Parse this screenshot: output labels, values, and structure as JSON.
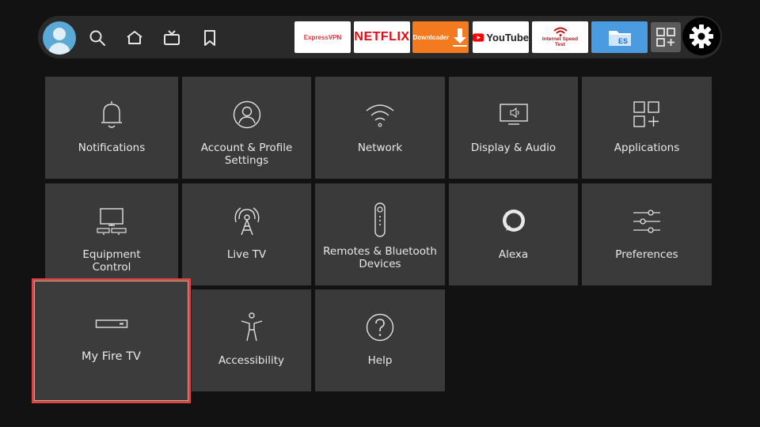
{
  "topbar": {
    "nav_icons": [
      "profile-avatar",
      "search-icon",
      "home-icon",
      "live-tv-icon",
      "bookmark-icon"
    ],
    "apps": [
      {
        "name": "ExpressVPN",
        "bg": "#ffffff",
        "fg": "#da3940"
      },
      {
        "name": "NETFLIX",
        "bg": "#ffffff",
        "fg": "#e50914"
      },
      {
        "name": "Downloader",
        "bg": "#f47a20",
        "fg": "#ffffff"
      },
      {
        "name": "YouTube",
        "bg": "#ffffff",
        "fg": "#222222"
      },
      {
        "name": "Internet Speed Test",
        "bg": "#ffffff",
        "fg": "#c0121b"
      },
      {
        "name": "ES",
        "bg": "#4a9be0",
        "fg": "#ffffff"
      }
    ]
  },
  "settings": {
    "tiles": [
      {
        "label": "Notifications",
        "icon": "bell-icon"
      },
      {
        "label": "Account & Profile Settings",
        "icon": "account-icon"
      },
      {
        "label": "Network",
        "icon": "wifi-icon"
      },
      {
        "label": "Display & Audio",
        "icon": "display-audio-icon"
      },
      {
        "label": "Applications",
        "icon": "applications-icon"
      },
      {
        "label": "Equipment Control",
        "icon": "equipment-icon"
      },
      {
        "label": "Live TV",
        "icon": "antenna-icon"
      },
      {
        "label": "Remotes & Bluetooth Devices",
        "icon": "remote-icon"
      },
      {
        "label": "Alexa",
        "icon": "alexa-icon"
      },
      {
        "label": "Preferences",
        "icon": "sliders-icon"
      },
      {
        "label": "My Fire TV",
        "icon": "firetv-device-icon"
      },
      {
        "label": "Accessibility",
        "icon": "accessibility-icon"
      },
      {
        "label": "Help",
        "icon": "help-icon"
      }
    ],
    "focused_tile": "My Fire TV"
  },
  "colors": {
    "background": "#121212",
    "tile": "#3a3a3a",
    "focus_border": "#d44848"
  }
}
